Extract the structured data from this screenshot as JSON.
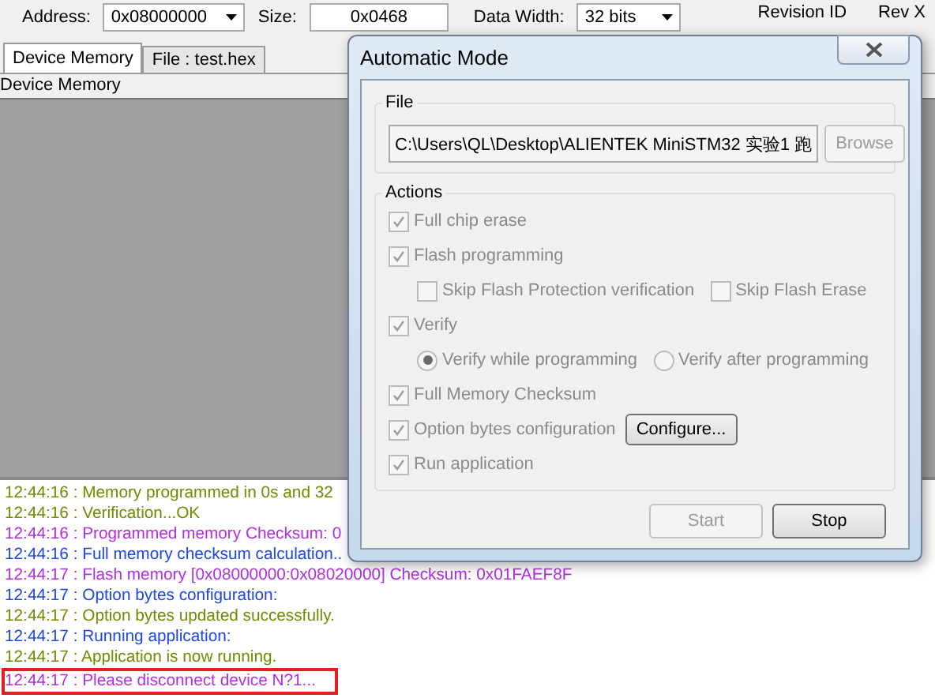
{
  "toolbar": {
    "address_label": "Address:",
    "address_value": "0x08000000",
    "size_label": "Size:",
    "size_value": "0x0468",
    "data_width_label": "Data Width:",
    "data_width_value": "32 bits",
    "revision_label": "Revision ID",
    "revision_value": "Rev X"
  },
  "tabs": [
    {
      "label": "Device Memory",
      "selected": true
    },
    {
      "label": "File : test.hex",
      "selected": false
    }
  ],
  "memory_panel": {
    "title": "Device Memory"
  },
  "log": [
    {
      "text": "12:44:16 : Memory programmed in 0s and 32",
      "color": "#6b8e00",
      "highlighted": false
    },
    {
      "text": "12:44:16 : Verification...OK",
      "color": "#6b8e00",
      "highlighted": false
    },
    {
      "text": "12:44:16 : Programmed memory Checksum: 0",
      "color": "#b22ee0",
      "highlighted": false
    },
    {
      "text": "12:44:16 : Full memory checksum calculation..",
      "color": "#1c46e6",
      "highlighted": false
    },
    {
      "text": "12:44:17 : Flash memory [0x08000000:0x08020000] Checksum: 0x01FAEF8F",
      "color": "#b22ee0",
      "highlighted": false
    },
    {
      "text": "12:44:17 : Option bytes configuration:",
      "color": "#1c46e6",
      "highlighted": false
    },
    {
      "text": "12:44:17 : Option bytes updated successfully.",
      "color": "#6b8e00",
      "highlighted": false
    },
    {
      "text": "12:44:17 : Running application:",
      "color": "#1c46e6",
      "highlighted": false
    },
    {
      "text": "12:44:17 : Application is now running.",
      "color": "#6b8e00",
      "highlighted": false
    },
    {
      "text": "12:44:17 : Please disconnect device N?1...",
      "color": "#b22ee0",
      "highlighted": true
    }
  ],
  "dialog": {
    "title": "Automatic Mode",
    "file_group": {
      "title": "File",
      "path": "C:\\Users\\QL\\Desktop\\ALIENTEK MiniSTM32 实验1 跑",
      "browse": {
        "label": "Browse",
        "disabled": true
      }
    },
    "actions_group": {
      "title": "Actions",
      "items": [
        {
          "kind": "checkbox",
          "label": "Full chip erase",
          "checked": true,
          "disabled": true
        },
        {
          "kind": "checkbox",
          "label": "Flash programming",
          "checked": true,
          "disabled": true,
          "children": [
            {
              "kind": "checkbox",
              "label": "Skip Flash Protection verification",
              "checked": false,
              "disabled": true
            },
            {
              "kind": "checkbox",
              "label": "Skip Flash Erase",
              "checked": false,
              "disabled": true
            }
          ]
        },
        {
          "kind": "checkbox",
          "label": "Verify",
          "checked": true,
          "disabled": true,
          "children": [
            {
              "kind": "radio",
              "label": "Verify while programming",
              "selected": true,
              "disabled": true
            },
            {
              "kind": "radio",
              "label": "Verify after programming",
              "selected": false,
              "disabled": true
            }
          ]
        },
        {
          "kind": "checkbox",
          "label": "Full Memory Checksum",
          "checked": true,
          "disabled": true
        },
        {
          "kind": "checkbox",
          "label": "Option bytes configuration",
          "checked": true,
          "disabled": true,
          "button": {
            "label": "Configure..."
          }
        },
        {
          "kind": "checkbox",
          "label": "Run application",
          "checked": true,
          "disabled": true
        }
      ]
    },
    "buttons": [
      {
        "label": "Start",
        "disabled": true
      },
      {
        "label": "Stop",
        "disabled": false
      }
    ]
  }
}
